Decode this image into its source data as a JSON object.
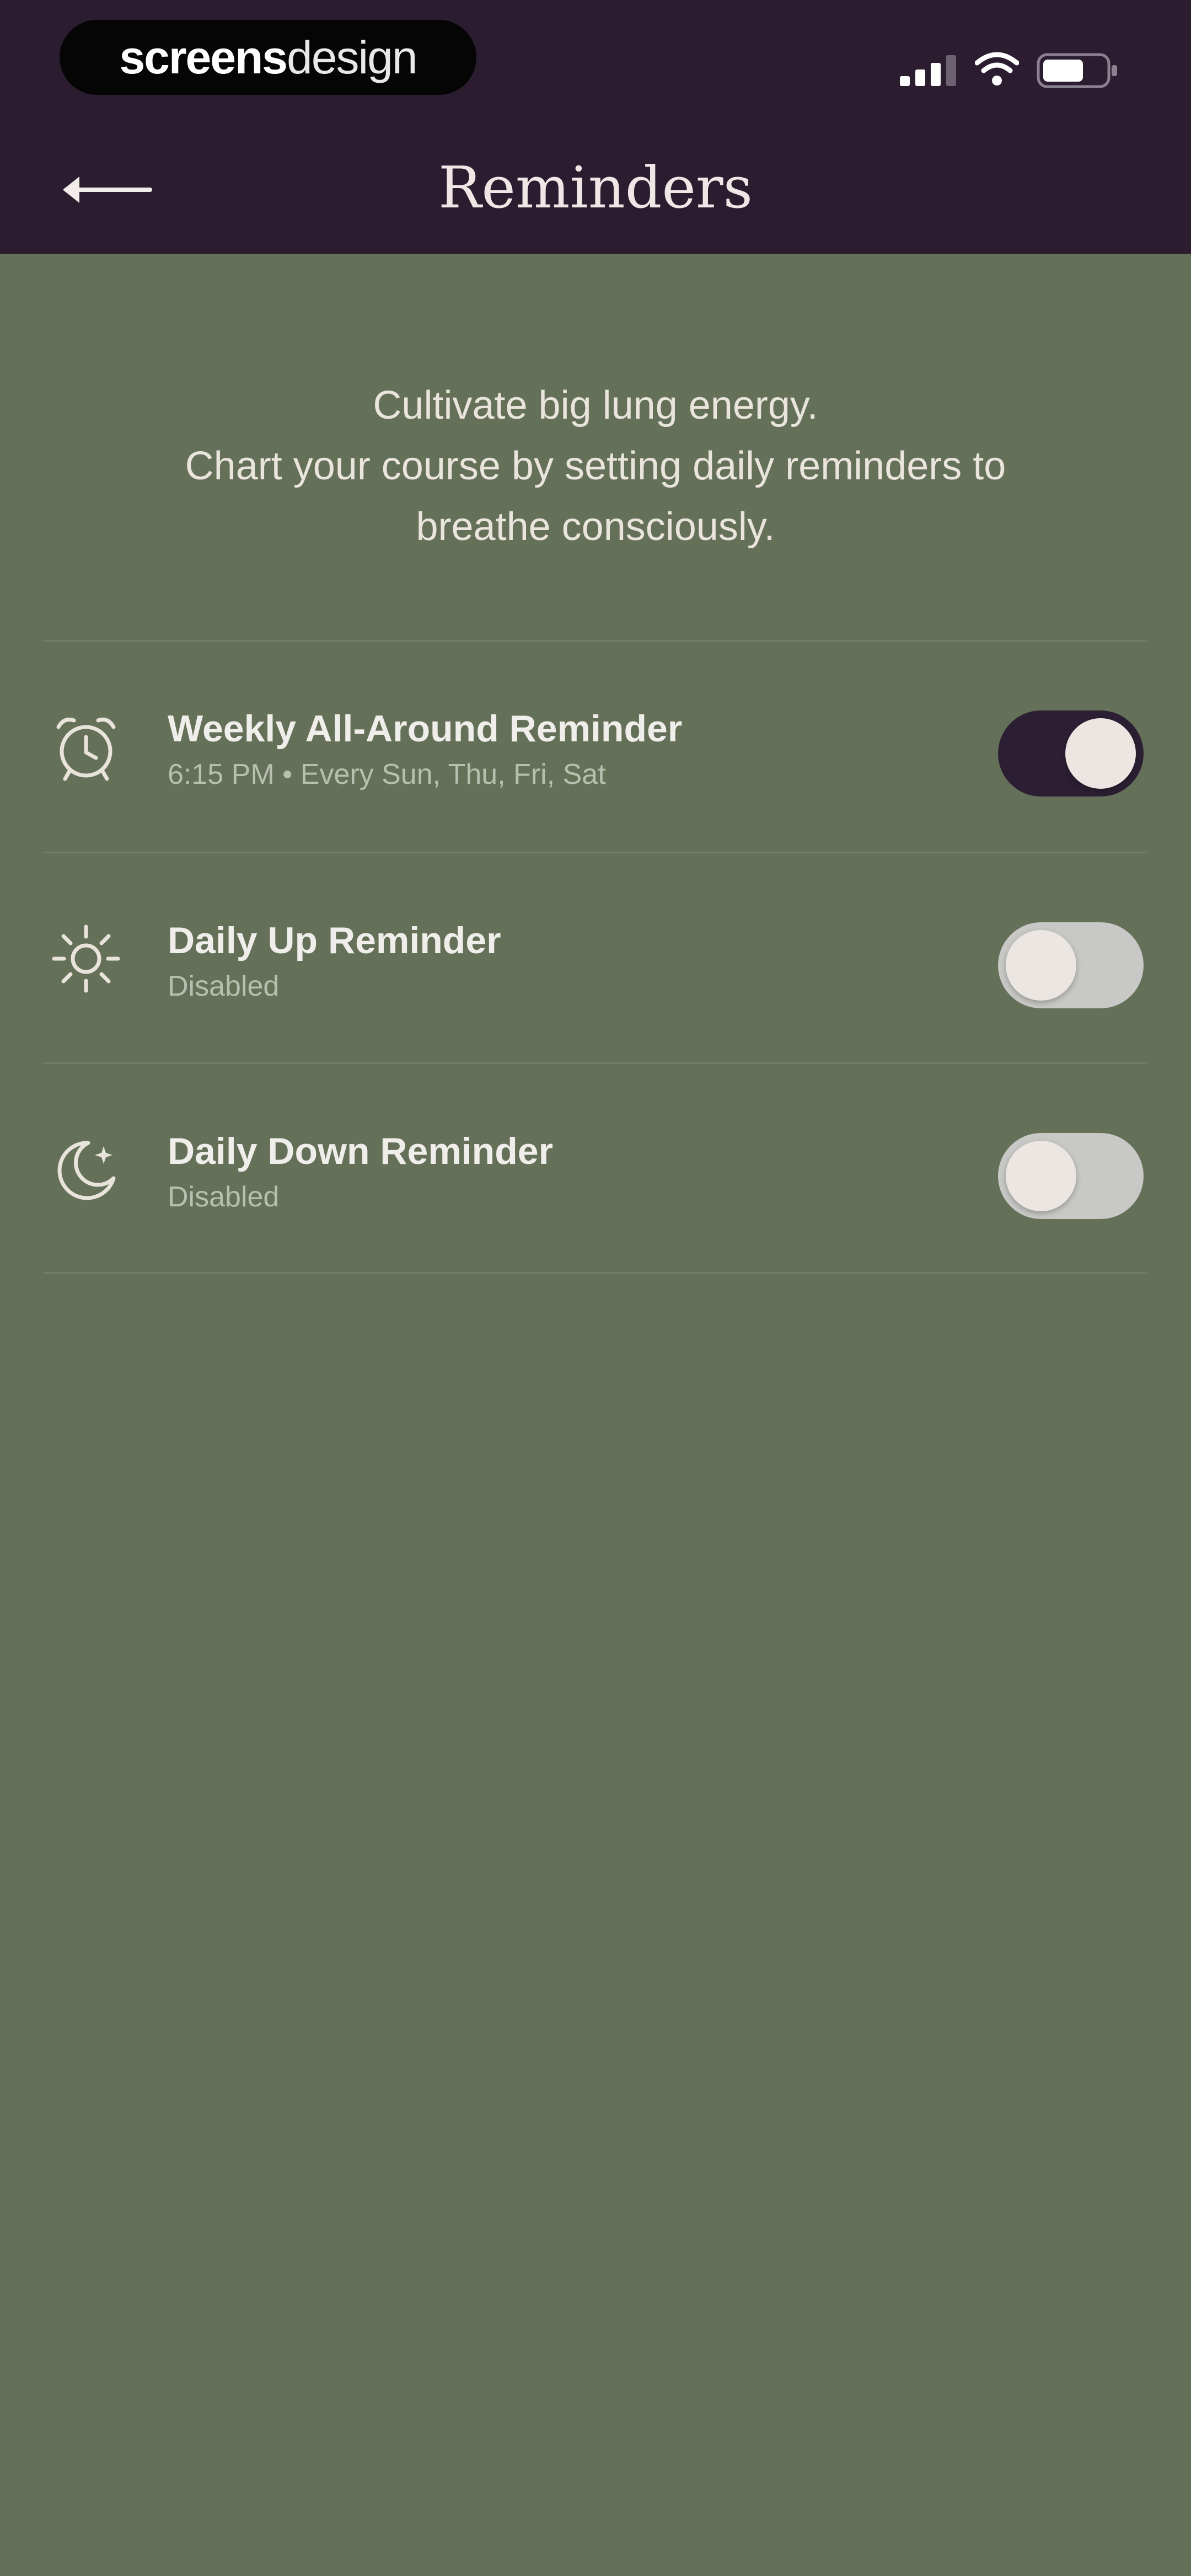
{
  "status_bar": {
    "brand": {
      "bold": "screens",
      "light": "design"
    }
  },
  "header": {
    "title": "Reminders",
    "back_icon": "arrow-left-icon"
  },
  "intro": {
    "line1": "Cultivate big lung energy.",
    "line2": "Chart your course by setting daily reminders to",
    "line3": "breathe consciously."
  },
  "reminders": [
    {
      "title": "Weekly All-Around Reminder",
      "subtitle": "6:15 PM • Every Sun, Thu, Fri, Sat",
      "icon": "alarm-clock-icon",
      "enabled": true
    },
    {
      "title": "Daily Up Reminder",
      "subtitle": "Disabled",
      "icon": "sun-icon",
      "enabled": false
    },
    {
      "title": "Daily Down Reminder",
      "subtitle": "Disabled",
      "icon": "moon-stars-icon",
      "enabled": false
    }
  ],
  "colors": {
    "header_bg": "#2b1d2f",
    "page_bg": "#657059",
    "toggle_on": "#2c1f33",
    "toggle_off": "#c8c8c6",
    "knob": "#ece6e3"
  }
}
